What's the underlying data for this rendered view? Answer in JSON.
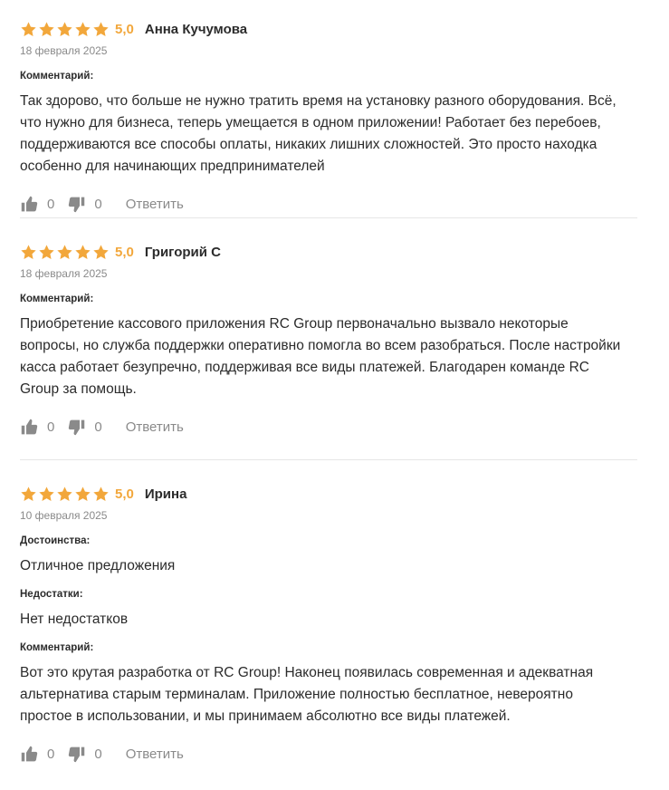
{
  "accent_color": "#f2a73b",
  "icons": {
    "star": "star-icon",
    "like": "thumbs-up-icon",
    "dislike": "thumbs-down-icon"
  },
  "reviews": [
    {
      "stars": 5,
      "rating": "5,0",
      "author": "Анна Кучумова",
      "date": "18 февраля 2025",
      "comment_label": "Комментарий:",
      "comment": "Так здорово, что больше не нужно тратить время на установку разного оборудования. Всё, что нужно для бизнеса, теперь умещается в одном приложении! Работает без перебоев, поддерживаются все способы оплаты, никаких лишних сложностей. Это просто находка особенно для начинающих предпринимателей",
      "likes": "0",
      "dislikes": "0",
      "reply_label": "Ответить"
    },
    {
      "stars": 5,
      "rating": "5,0",
      "author": "Григорий С",
      "date": "18 февраля 2025",
      "comment_label": "Комментарий:",
      "comment": "Приобретение кассового приложения RC Group первоначально вызвало некоторые вопросы, но служба поддержки оперативно помогла во всем разобраться. После настройки касса работает безупречно, поддерживая все виды платежей. Благодарен команде RC Group за помощь.",
      "likes": "0",
      "dislikes": "0",
      "reply_label": "Ответить"
    },
    {
      "stars": 5,
      "rating": "5,0",
      "author": "Ирина",
      "date": "10 февраля 2025",
      "pros_label": "Достоинства:",
      "pros": "Отличное предложения",
      "cons_label": "Недостатки:",
      "cons": "Нет недостатков",
      "comment_label": "Комментарий:",
      "comment": "Вот это крутая разработка от RC Group! Наконец появилась современная и адекватная альтернатива старым терминалам. Приложение полностью бесплатное, невероятно простое в использовании, и мы принимаем абсолютно все виды платежей.",
      "likes": "0",
      "dislikes": "0",
      "reply_label": "Ответить"
    }
  ]
}
